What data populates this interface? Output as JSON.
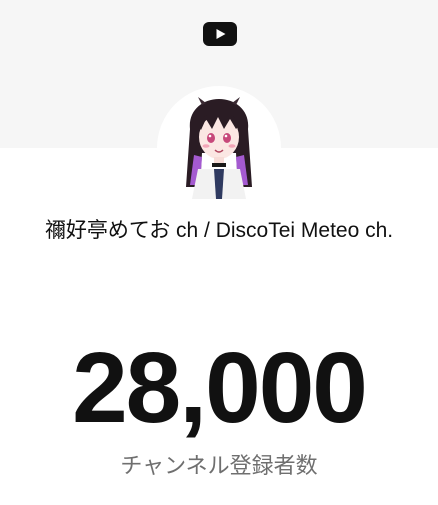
{
  "header": {
    "logo_icon": "youtube-logo-icon"
  },
  "channel": {
    "avatar_icon": "channel-avatar",
    "name": "禰好亭めてお ch / DiscoTei Meteo ch."
  },
  "stats": {
    "subscriber_count": "28,000",
    "subscriber_label": "チャンネル登録者数"
  },
  "colors": {
    "banner_bg": "#f6f6f6",
    "text_primary": "#111111",
    "text_secondary": "#6f6f6f"
  }
}
